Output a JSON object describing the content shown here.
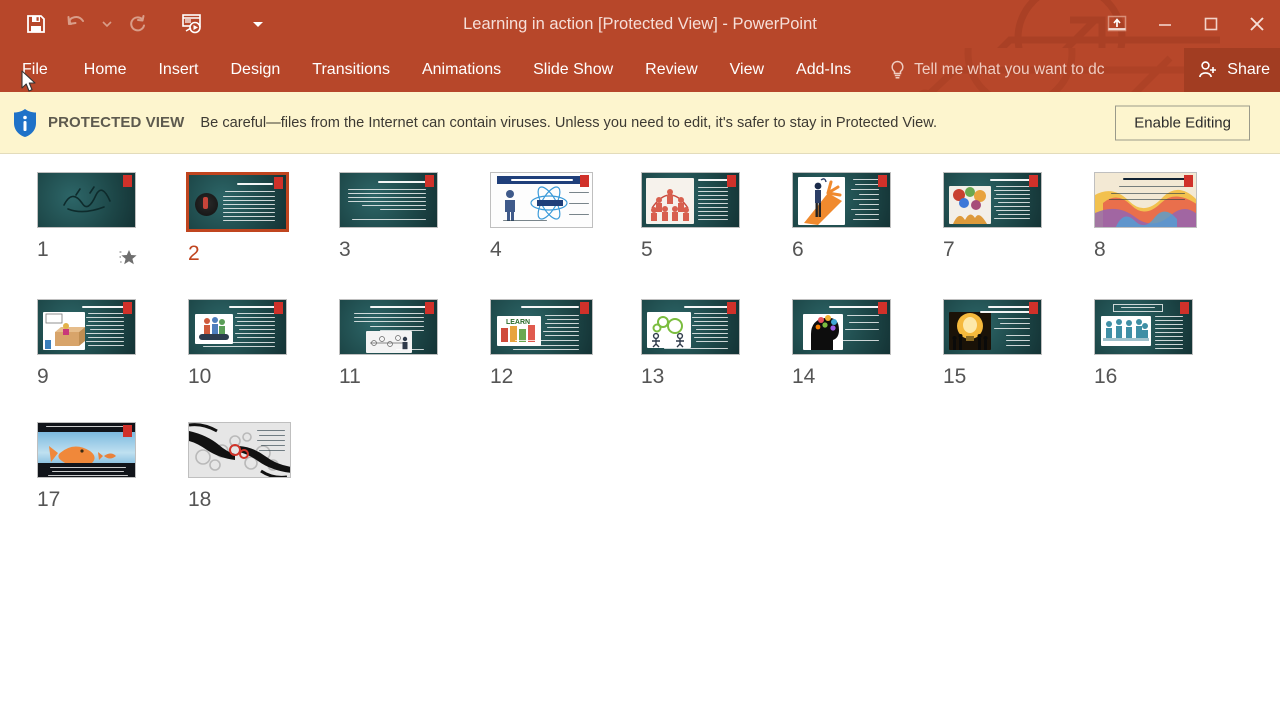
{
  "app": {
    "title": "Learning in action [Protected View] - PowerPoint",
    "accent_color": "#b7472a",
    "share_label": "Share"
  },
  "quick_access": {
    "items": [
      {
        "name": "save-icon",
        "label": "Save",
        "enabled": true
      },
      {
        "name": "undo-icon",
        "label": "Undo",
        "enabled": false
      },
      {
        "name": "undo-dropdown-icon",
        "label": "Undo options",
        "enabled": false
      },
      {
        "name": "redo-icon",
        "label": "Redo",
        "enabled": false
      },
      {
        "name": "start-slideshow-icon",
        "label": "Start From Beginning",
        "enabled": true
      },
      {
        "name": "customize-qat-icon",
        "label": "Customize Quick Access Toolbar",
        "enabled": true
      }
    ]
  },
  "window_controls": {
    "ribbon_display_options": "Ribbon Display Options",
    "minimize": "Minimize",
    "restore": "Restore Down",
    "close": "Close"
  },
  "ribbon": {
    "tabs": [
      {
        "label": "File",
        "active": false
      },
      {
        "label": "Home",
        "active": false
      },
      {
        "label": "Insert",
        "active": false
      },
      {
        "label": "Design",
        "active": false
      },
      {
        "label": "Transitions",
        "active": false
      },
      {
        "label": "Animations",
        "active": false
      },
      {
        "label": "Slide Show",
        "active": false
      },
      {
        "label": "Review",
        "active": false
      },
      {
        "label": "View",
        "active": false
      },
      {
        "label": "Add-Ins",
        "active": false
      }
    ],
    "tell_me": "Tell me what you want to dc"
  },
  "protected_view": {
    "label": "PROTECTED VIEW",
    "message": "Be careful—files from the Internet can contain viruses. Unless you need to edit, it's safer to stay in Protected View.",
    "button": "Enable Editing",
    "background_color": "#fdf5ce",
    "icon": "info-shield-icon"
  },
  "slide_sorter": {
    "selected_slide": 2,
    "slides": [
      {
        "number": "1",
        "style": "title-calligraphy",
        "selected": false,
        "has_animation": true
      },
      {
        "number": "2",
        "style": "teal-photo-left",
        "selected": true,
        "has_animation": false
      },
      {
        "number": "3",
        "style": "teal-text",
        "selected": false,
        "has_animation": false
      },
      {
        "number": "4",
        "style": "white-diagram",
        "selected": false,
        "has_animation": false
      },
      {
        "number": "5",
        "style": "teal-photo-left",
        "selected": false,
        "has_animation": false
      },
      {
        "number": "6",
        "style": "white-figure",
        "selected": false,
        "has_animation": false
      },
      {
        "number": "7",
        "style": "teal-photo-left",
        "selected": false,
        "has_animation": false
      },
      {
        "number": "8",
        "style": "colorful-photo",
        "selected": false,
        "has_animation": false
      },
      {
        "number": "9",
        "style": "teal-photo-left",
        "selected": false,
        "has_animation": false
      },
      {
        "number": "10",
        "style": "teal-photo-left",
        "selected": false,
        "has_animation": false
      },
      {
        "number": "11",
        "style": "teal-photo-right",
        "selected": false,
        "has_animation": false
      },
      {
        "number": "12",
        "style": "teal-photo-left",
        "selected": false,
        "has_animation": false
      },
      {
        "number": "13",
        "style": "teal-photo-left",
        "selected": false,
        "has_animation": false
      },
      {
        "number": "14",
        "style": "teal-head",
        "selected": false,
        "has_animation": false
      },
      {
        "number": "15",
        "style": "teal-lamp",
        "selected": false,
        "has_animation": false
      },
      {
        "number": "16",
        "style": "teal-people",
        "selected": false,
        "has_animation": false
      },
      {
        "number": "17",
        "style": "fish-blue",
        "selected": false,
        "has_animation": false
      },
      {
        "number": "18",
        "style": "hands-gears",
        "selected": false,
        "has_animation": false
      }
    ]
  }
}
